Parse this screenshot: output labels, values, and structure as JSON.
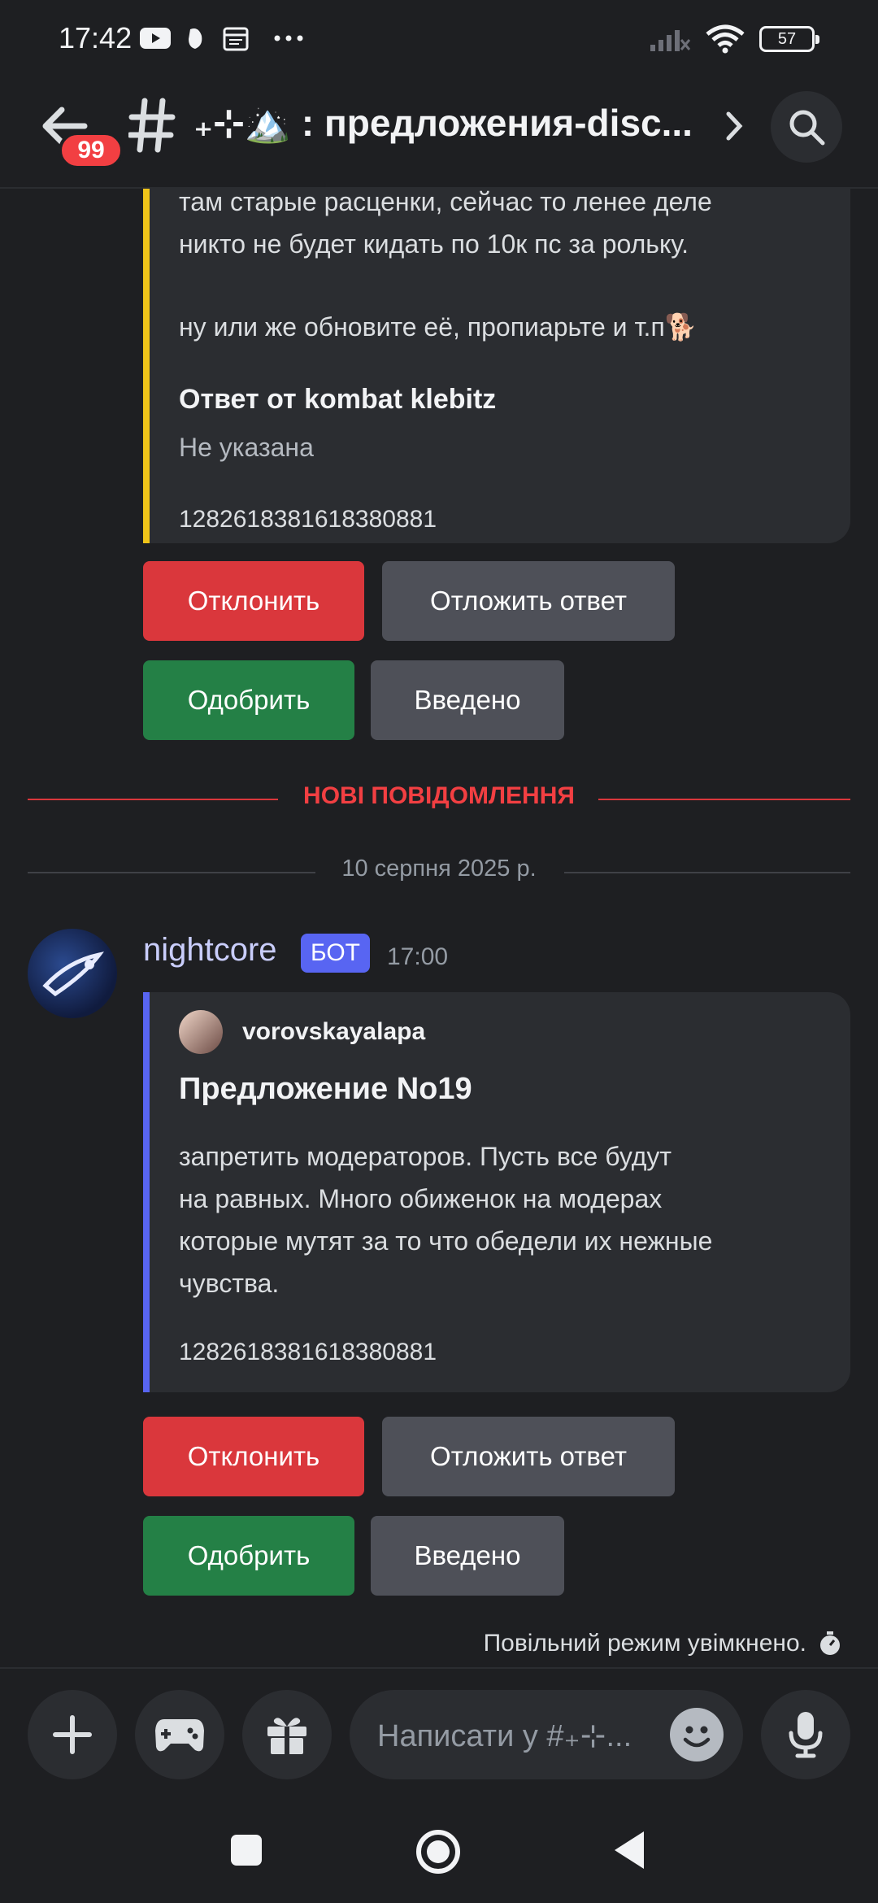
{
  "status_bar": {
    "time": "17:42",
    "battery": "57",
    "icons": [
      "youtube-icon",
      "notification-icon",
      "calendar-icon",
      "more-icon",
      "signal-icon",
      "wifi-icon",
      "battery-icon"
    ]
  },
  "header": {
    "unread_badge": "99",
    "channel_name": "₊⊹🏔️ : предложения-disc...",
    "icons": [
      "back-arrow-icon",
      "hash-icon",
      "chevron-right-icon",
      "search-icon"
    ]
  },
  "message_top": {
    "embed_text_line1": "там старые расценки, сейчас то ленее деле",
    "embed_text_line2": "никто не будет кидать по 10к пс за рольку.",
    "embed_text_line3": "ну или же обновите её, пропиарьте и т.п🐕",
    "answer_title": "Ответ от kombat klebitz",
    "answer_value": "Не указана",
    "footer": "1282618381618380881",
    "accent_color": "#f0c419"
  },
  "buttons_top": {
    "decline": "Отклонить",
    "postpone": "Отложить ответ",
    "approve": "Одобрить",
    "implemented": "Введено"
  },
  "dividers": {
    "new_messages": "НОВІ ПОВІДОМЛЕННЯ",
    "date": "10 серпня 2025 р."
  },
  "message_bot": {
    "author": "nightcore",
    "bot_tag": "БОТ",
    "time": "17:00",
    "embed": {
      "author_name": "vorovskayalapa",
      "title": "Предложение No19",
      "desc_line1": "запретить модераторов. Пусть все будут",
      "desc_line2": "на равных. Много обиженок на модерах",
      "desc_line3": "которые мутят за то что обедели их нежные",
      "desc_line4": "чувства.",
      "footer": "1282618381618380881",
      "accent_color": "#5865f2"
    }
  },
  "buttons_bot": {
    "decline": "Отклонить",
    "postpone": "Отложить ответ",
    "approve": "Одобрить",
    "implemented": "Введено"
  },
  "slowmode": {
    "text": "Повільний режим увімкнено."
  },
  "composer": {
    "placeholder": "Написати у #₊⊹...",
    "icons": [
      "plus-icon",
      "gamepad-icon",
      "gift-icon",
      "emoji-icon",
      "microphone-icon"
    ]
  },
  "navbar": {
    "icons": [
      "recents-square-icon",
      "home-circle-icon",
      "back-triangle-icon"
    ]
  }
}
